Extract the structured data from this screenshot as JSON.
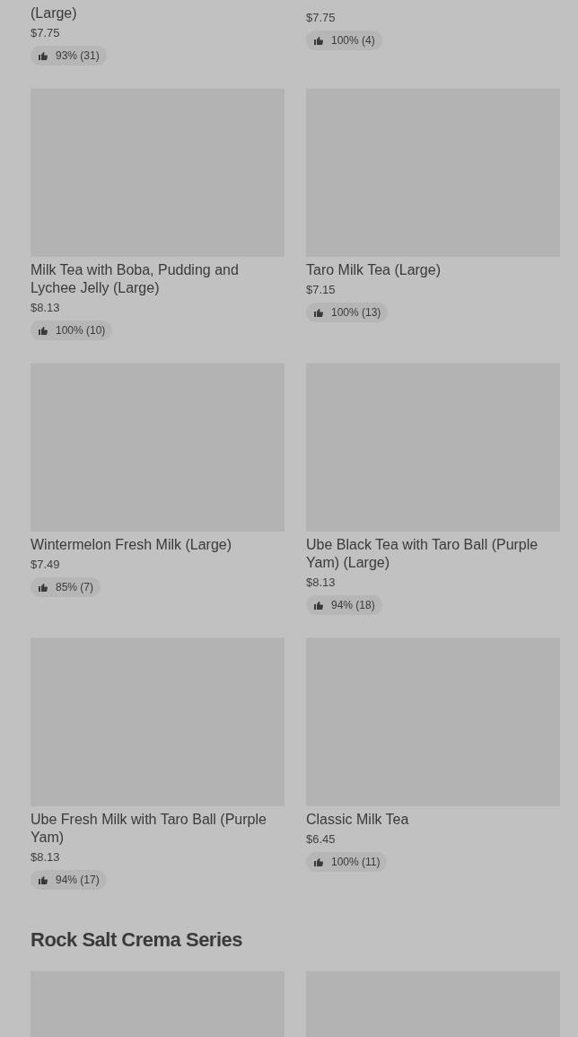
{
  "sections": [
    {
      "items": [
        {
          "kind": "product",
          "title": "(Large)",
          "price": "$7.75",
          "rating": "93% (31)",
          "image": false
        },
        {
          "kind": "product",
          "price": "$7.75",
          "rating": "100% (4)",
          "image": false
        },
        {
          "kind": "product",
          "title": "Milk Tea with Boba, Pudding and Lychee Jelly (Large)",
          "price": "$8.13",
          "rating": "100% (10)",
          "image": true
        },
        {
          "kind": "product",
          "title": "Taro Milk Tea (Large)",
          "price": "$7.15",
          "rating": "100% (13)",
          "image": true
        },
        {
          "kind": "product",
          "title": "Wintermelon Fresh Milk (Large)",
          "price": "$7.49",
          "rating": "85% (7)",
          "image": true
        },
        {
          "kind": "product",
          "title": "Ube Black Tea with Taro Ball (Purple Yam) (Large)",
          "price": "$8.13",
          "rating": "94% (18)",
          "image": true
        },
        {
          "kind": "product",
          "title": "Ube Fresh Milk with Taro Ball (Purple Yam)",
          "price": "$8.13",
          "rating": "94% (17)",
          "image": true
        },
        {
          "kind": "product",
          "title": "Classic Milk Tea",
          "price": "$6.45",
          "rating": "100% (11)",
          "image": true
        }
      ]
    },
    {
      "title": "Rock Salt Crema Series",
      "items": [
        {
          "kind": "image_only",
          "image": true
        },
        {
          "kind": "image_only",
          "image": true
        }
      ]
    }
  ]
}
